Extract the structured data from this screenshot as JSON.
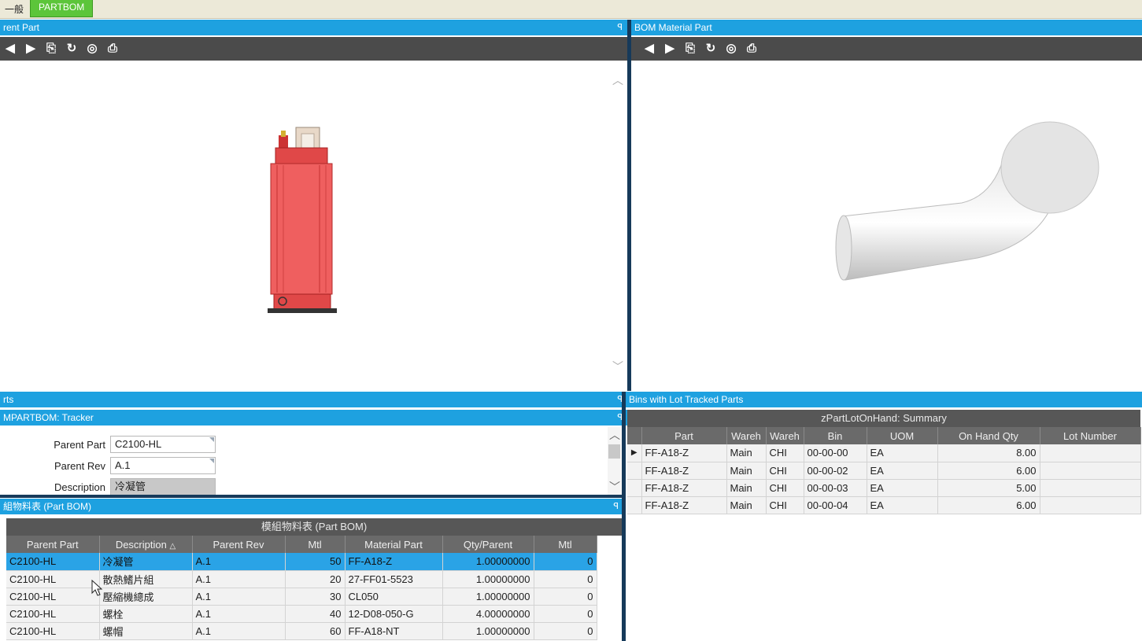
{
  "tabs": {
    "general": "一般",
    "partbom": "PARTBOM"
  },
  "panels": {
    "parent_part": {
      "title": "rent Part"
    },
    "bom_material_part": {
      "title": "BOM Material Part"
    },
    "parts": {
      "title": "rts"
    },
    "tracker": {
      "title": "MPARTBOM: Tracker"
    },
    "part_bom": {
      "title": "組物料表 (Part BOM)"
    },
    "bins": {
      "title": "Bins with Lot Tracked Parts"
    }
  },
  "toolbar_icons": [
    "back-icon",
    "forward-icon",
    "export-icon",
    "refresh-icon",
    "globe-icon",
    "print-icon"
  ],
  "tracker": {
    "parent_part_label": "Parent Part",
    "parent_part_value": "C2100-HL",
    "parent_rev_label": "Parent Rev",
    "parent_rev_value": "A.1",
    "description_label": "Description",
    "description_value": "冷凝管"
  },
  "part_bom": {
    "grid_title": "模組物料表 (Part BOM)",
    "columns": [
      "Parent Part",
      "Description",
      "Parent Rev",
      "Mtl",
      "Material Part",
      "Qty/Parent",
      "Mtl"
    ],
    "sort_indicator": "△",
    "rows": [
      {
        "parent_part": "C2100-HL",
        "description": "冷凝管",
        "parent_rev": "A.1",
        "mtl": "50",
        "material_part": "FF-A18-Z",
        "qty": "1.00000000",
        "mtl2": "0"
      },
      {
        "parent_part": "C2100-HL",
        "description": "散熱鰭片組",
        "parent_rev": "A.1",
        "mtl": "20",
        "material_part": "27-FF01-5523",
        "qty": "1.00000000",
        "mtl2": "0"
      },
      {
        "parent_part": "C2100-HL",
        "description": "壓縮機總成",
        "parent_rev": "A.1",
        "mtl": "30",
        "material_part": "CL050",
        "qty": "1.00000000",
        "mtl2": "0"
      },
      {
        "parent_part": "C2100-HL",
        "description": "螺栓",
        "parent_rev": "A.1",
        "mtl": "40",
        "material_part": "12-D08-050-G",
        "qty": "4.00000000",
        "mtl2": "0"
      },
      {
        "parent_part": "C2100-HL",
        "description": "螺帽",
        "parent_rev": "A.1",
        "mtl": "60",
        "material_part": "FF-A18-NT",
        "qty": "1.00000000",
        "mtl2": "0"
      }
    ]
  },
  "bins": {
    "grid_title": "zPartLotOnHand: Summary",
    "columns": [
      "Part",
      "Wareh",
      "Wareh",
      "Bin",
      "UOM",
      "On Hand Qty",
      "Lot Number"
    ],
    "rows": [
      {
        "part": "FF-A18-Z",
        "wh1": "Main",
        "wh2": "CHI",
        "bin": "00-00-00",
        "uom": "EA",
        "qty": "8.00",
        "lot": ""
      },
      {
        "part": "FF-A18-Z",
        "wh1": "Main",
        "wh2": "CHI",
        "bin": "00-00-02",
        "uom": "EA",
        "qty": "6.00",
        "lot": ""
      },
      {
        "part": "FF-A18-Z",
        "wh1": "Main",
        "wh2": "CHI",
        "bin": "00-00-03",
        "uom": "EA",
        "qty": "5.00",
        "lot": ""
      },
      {
        "part": "FF-A18-Z",
        "wh1": "Main",
        "wh2": "CHI",
        "bin": "00-00-04",
        "uom": "EA",
        "qty": "6.00",
        "lot": ""
      }
    ]
  },
  "colors": {
    "header_blue": "#1ea1e0",
    "tab_green": "#5cc53a",
    "selection_blue": "#2aa3e6",
    "toolbar_dark": "#4b4b4b"
  }
}
